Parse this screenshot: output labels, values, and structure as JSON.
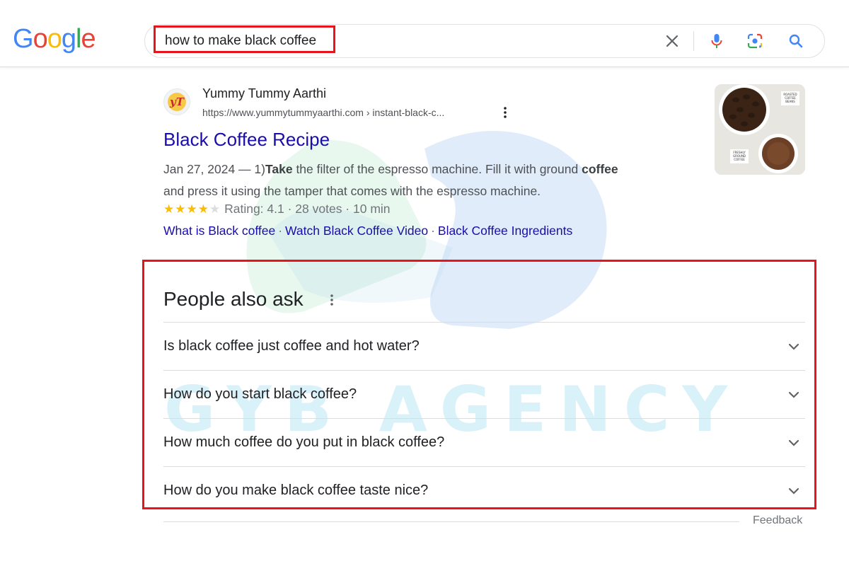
{
  "header": {
    "logo_letters": [
      "G",
      "o",
      "o",
      "g",
      "l",
      "e"
    ],
    "search_query": "how to make black coffee",
    "icons": {
      "clear": "close-icon",
      "voice": "microphone-icon",
      "lens": "camera-lens-icon",
      "search": "search-icon"
    }
  },
  "result": {
    "site_name": "Yummy Tummy Aarthi",
    "favicon_text": "yT",
    "url": "https://www.yummytummyaarthi.com › instant-black-c...",
    "title": "Black Coffee Recipe",
    "snippet": {
      "date": "Jan 27, 2024 — 1)",
      "bold1": "Take",
      "text1": " the filter of the espresso machine. Fill it with ground ",
      "bold2": "coffee",
      "text2": "and press it using the tamper that comes with the espresso machine."
    },
    "rating": {
      "stars_filled": 4,
      "stars_total": 5,
      "text": "Rating: 4.1 · 28 votes · 10 min"
    },
    "sitelinks": [
      "What is Black coffee",
      "Watch Black Coffee Video",
      "Black Coffee Ingredients"
    ],
    "sitelink_separator": "·",
    "thumbnail_labels": {
      "top": [
        "ROASTED",
        "COFFEE",
        "BEANS"
      ],
      "bottom": [
        "FRESHLY",
        "GROUND",
        "COFFEE"
      ]
    }
  },
  "people_also_ask": {
    "heading": "People also ask",
    "questions": [
      "Is black coffee just coffee and hot water?",
      "How do you start black coffee?",
      "How much coffee do you put in black coffee?",
      "How do you make black coffee taste nice?"
    ]
  },
  "feedback_label": "Feedback",
  "watermark_text": "GYB AGENCY",
  "colors": {
    "highlight_red": "#e8131b",
    "link_blue": "#1a0dab",
    "star_yellow": "#fbbc04"
  }
}
